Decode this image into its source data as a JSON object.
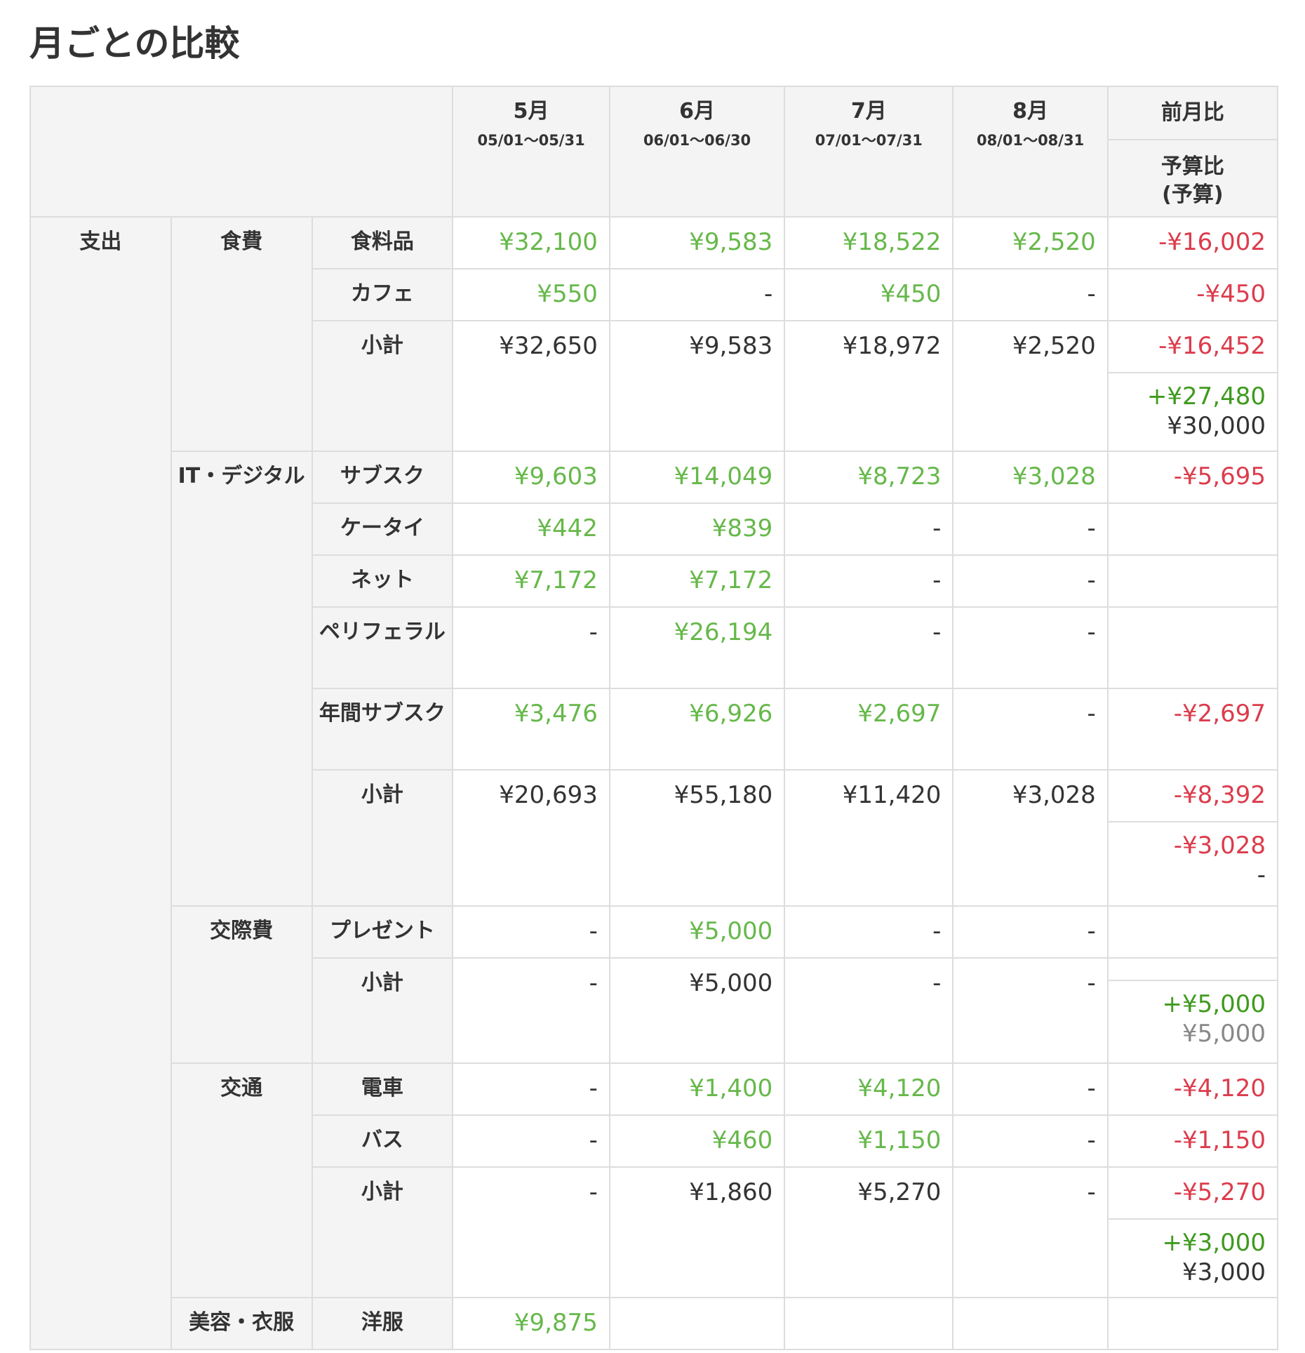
{
  "title": "月ごとの比較",
  "header": {
    "months": [
      {
        "name": "5月",
        "range": "05/01〜05/31"
      },
      {
        "name": "6月",
        "range": "06/01〜06/30"
      },
      {
        "name": "7月",
        "range": "07/01〜07/31"
      },
      {
        "name": "8月",
        "range": "08/01〜08/31"
      }
    ],
    "mom_label": "前月比",
    "budget_label_1": "予算比",
    "budget_label_2": "(予算)"
  },
  "section": "支出",
  "groups": [
    {
      "name": "食費",
      "items": [
        {
          "name": "食料品",
          "values": [
            "¥32,100",
            "¥9,583",
            "¥18,522",
            "¥2,520"
          ],
          "mom": "-¥16,002"
        },
        {
          "name": "カフェ",
          "values": [
            "¥550",
            "-",
            "¥450",
            "-"
          ],
          "mom": "-¥450"
        }
      ],
      "subtotal": {
        "name": "小計",
        "values": [
          "¥32,650",
          "¥9,583",
          "¥18,972",
          "¥2,520"
        ],
        "mom": "-¥16,452",
        "budget_diff": "+¥27,480",
        "budget": "¥30,000"
      }
    },
    {
      "name": "IT・デジタル",
      "items": [
        {
          "name": "サブスク",
          "values": [
            "¥9,603",
            "¥14,049",
            "¥8,723",
            "¥3,028"
          ],
          "mom": "-¥5,695"
        },
        {
          "name": "ケータイ",
          "values": [
            "¥442",
            "¥839",
            "-",
            "-"
          ],
          "mom": ""
        },
        {
          "name": "ネット",
          "values": [
            "¥7,172",
            "¥7,172",
            "-",
            "-"
          ],
          "mom": ""
        },
        {
          "name": "ペリフェラル",
          "values": [
            "-",
            "¥26,194",
            "-",
            "-"
          ],
          "mom": ""
        },
        {
          "name": "年間サブスク",
          "values": [
            "¥3,476",
            "¥6,926",
            "¥2,697",
            "-"
          ],
          "mom": "-¥2,697"
        }
      ],
      "subtotal": {
        "name": "小計",
        "values": [
          "¥20,693",
          "¥55,180",
          "¥11,420",
          "¥3,028"
        ],
        "mom": "-¥8,392",
        "budget_diff": "-¥3,028",
        "budget": "-"
      }
    },
    {
      "name": "交際費",
      "items": [
        {
          "name": "プレゼント",
          "values": [
            "-",
            "¥5,000",
            "-",
            "-"
          ],
          "mom": ""
        }
      ],
      "subtotal": {
        "name": "小計",
        "values": [
          "-",
          "¥5,000",
          "-",
          "-"
        ],
        "mom": "",
        "budget_diff": "+¥5,000",
        "budget": "¥5,000"
      }
    },
    {
      "name": "交通",
      "items": [
        {
          "name": "電車",
          "values": [
            "-",
            "¥1,400",
            "¥4,120",
            "-"
          ],
          "mom": "-¥4,120"
        },
        {
          "name": "バス",
          "values": [
            "-",
            "¥460",
            "¥1,150",
            "-"
          ],
          "mom": "-¥1,150"
        }
      ],
      "subtotal": {
        "name": "小計",
        "values": [
          "-",
          "¥1,860",
          "¥5,270",
          "-"
        ],
        "mom": "-¥5,270",
        "budget_diff": "+¥3,000",
        "budget": "¥3,000"
      }
    },
    {
      "name": "美容・衣服",
      "items": [
        {
          "name": "洋服",
          "values": [
            "¥9,875",
            "",
            "",
            ""
          ],
          "mom": ""
        }
      ]
    }
  ],
  "colors": {
    "value_green": "#66b84a",
    "negative_red": "#dc3c4c",
    "positive_green": "#3f9a1f",
    "muted_gray": "#888888",
    "label_bg": "#f4f4f4",
    "border": "#dddddd"
  }
}
